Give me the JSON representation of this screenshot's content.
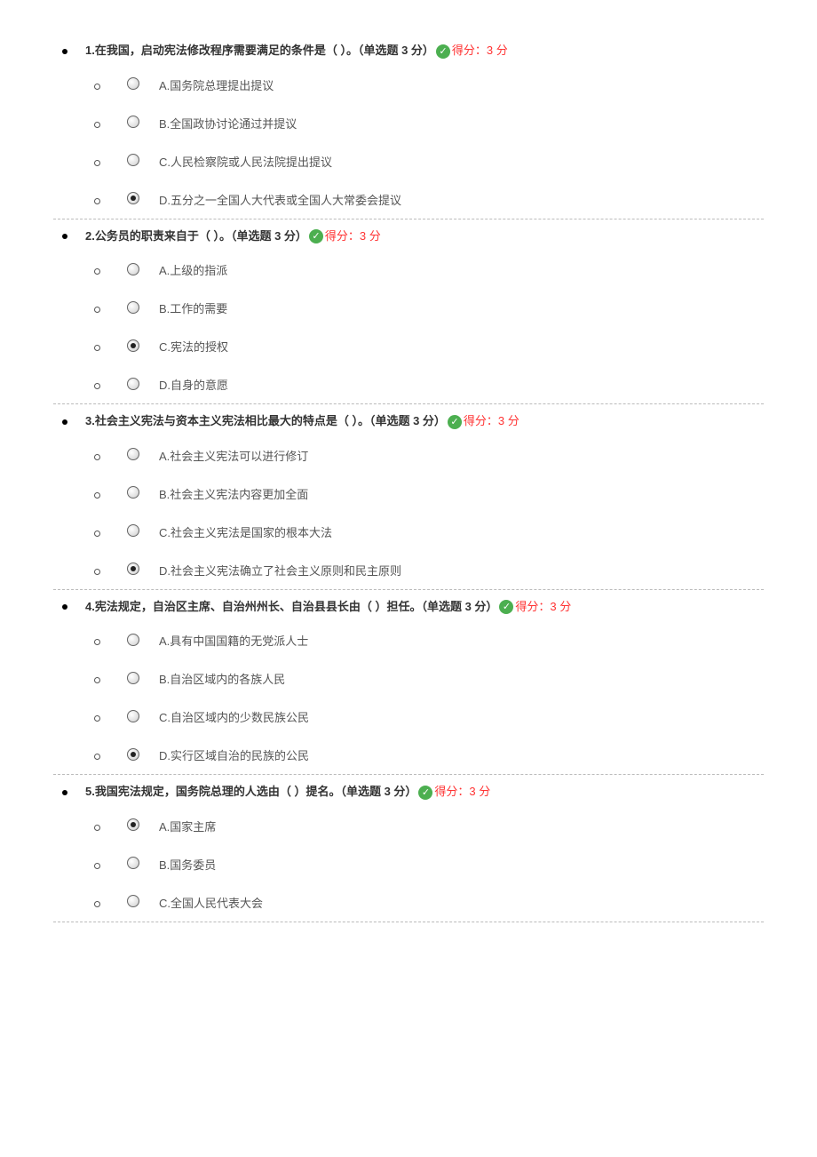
{
  "score_label": "得分：3 分",
  "questions": [
    {
      "text": "1.在我国，启动宪法修改程序需要满足的条件是（   ）。（单选题 3 分）",
      "selected": 3,
      "options": [
        "A.国务院总理提出提议",
        "B.全国政协讨论通过并提议",
        "C.人民检察院或人民法院提出提议",
        "D.五分之一全国人大代表或全国人大常委会提议"
      ]
    },
    {
      "text": "2.公务员的职责来自于（   ）。（单选题 3 分）",
      "selected": 2,
      "options": [
        "A.上级的指派",
        "B.工作的需要",
        "C.宪法的授权",
        "D.自身的意愿"
      ]
    },
    {
      "text": "3.社会主义宪法与资本主义宪法相比最大的特点是（   ）。（单选题 3 分）",
      "selected": 3,
      "options": [
        "A.社会主义宪法可以进行修订",
        "B.社会主义宪法内容更加全面",
        "C.社会主义宪法是国家的根本大法",
        "D.社会主义宪法确立了社会主义原则和民主原则"
      ]
    },
    {
      "text": "4.宪法规定，自治区主席、自治州州长、自治县县长由（   ）担任。（单选题 3 分）",
      "selected": 3,
      "options": [
        "A.具有中国国籍的无党派人士",
        "B.自治区域内的各族人民",
        "C.自治区域内的少数民族公民",
        "D.实行区域自治的民族的公民"
      ]
    },
    {
      "text": "5.我国宪法规定，国务院总理的人选由（  ）提名。（单选题 3 分）",
      "selected": 0,
      "options": [
        "A.国家主席",
        "B.国务委员",
        "C.全国人民代表大会"
      ]
    }
  ]
}
